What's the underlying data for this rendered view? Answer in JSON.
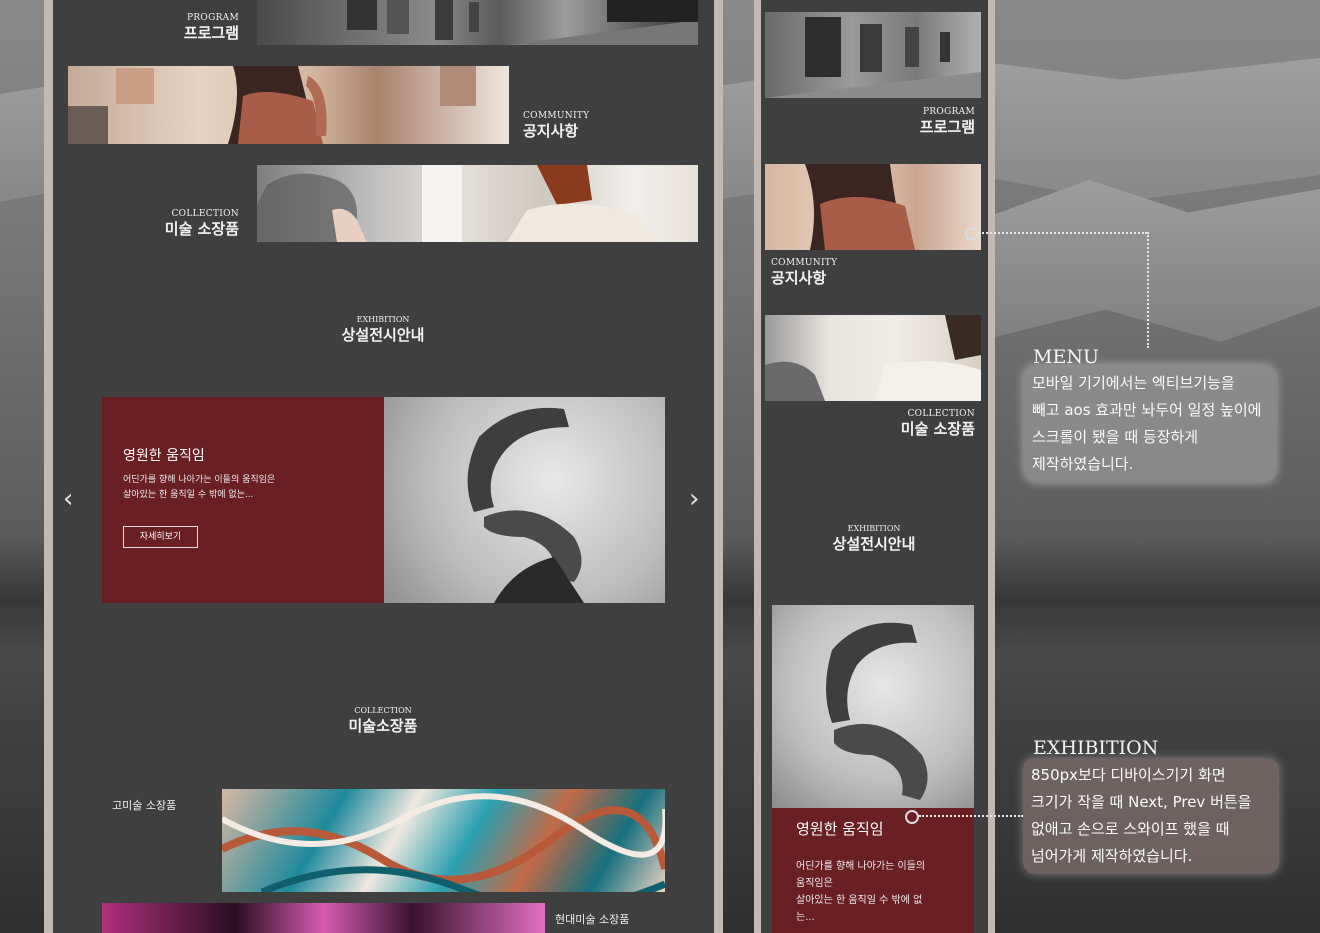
{
  "desktop": {
    "menu": [
      {
        "en": "PROGRAM",
        "ko": "프로그램"
      },
      {
        "en": "COMMUNITY",
        "ko": "공지사항"
      },
      {
        "en": "COLLECTION",
        "ko": "미술 소장품"
      }
    ],
    "exhibition_section": {
      "en": "EXHIBITION",
      "ko": "상설전시안내"
    },
    "slide": {
      "title": "영원한 움직임",
      "desc_line1": "어딘가를 향해 나아가는 이들의 움직임은",
      "desc_line2": "살아있는 한 움직일 수 밖에 없는...",
      "button": "자세히보기"
    },
    "prev_arrow": "‹",
    "next_arrow": "›",
    "collection_section": {
      "en": "COLLECTION",
      "ko": "미술소장품"
    },
    "collection_items": [
      "고미술 소장품",
      "현대미술 소장품"
    ]
  },
  "mobile": {
    "menu": [
      {
        "en": "PROGRAM",
        "ko": "프로그램"
      },
      {
        "en": "COMMUNITY",
        "ko": "공지사항"
      },
      {
        "en": "COLLECTION",
        "ko": "미술 소장품"
      }
    ],
    "exhibition_section": {
      "en": "EXHIBITION",
      "ko": "상설전시안내"
    },
    "slide": {
      "title": "영원한 움직임",
      "desc_line1": "어딘가를 향해 나아가는 이들의",
      "desc_line2": "움직임은",
      "desc_line3": "살아있는 한 움직일 수 밖에 없",
      "desc_line4": "는..."
    }
  },
  "notes": {
    "menu": {
      "heading": "MENU",
      "lines": [
        "모바일 기기에서는 엑티브기능을",
        "빼고 aos 효과만 놔두어 일정 높이에",
        "스크롤이 됐을 때 등장하게",
        "제작하였습니다."
      ]
    },
    "exhibition": {
      "heading": "EXHIBITION",
      "lines": [
        "850px보다 디바이스기기 화면",
        "크기가 작을 때 Next, Prev 버튼을",
        "없애고 손으로 스와이프 했을 때",
        "넘어가게 제작하였습니다."
      ]
    }
  },
  "colors": {
    "accent": "#6a1f22",
    "panel": "#3f3f3f",
    "frame": "#c2b9b5"
  }
}
